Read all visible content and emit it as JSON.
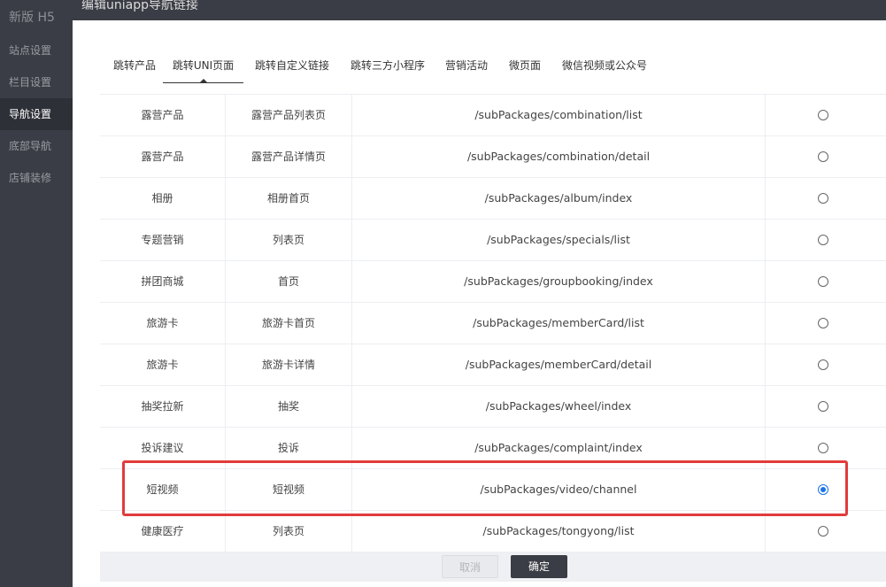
{
  "sidebar": {
    "brand": "新版 H5",
    "items": [
      {
        "label": "站点设置"
      },
      {
        "label": "栏目设置"
      },
      {
        "label": "导航设置"
      },
      {
        "label": "底部导航"
      },
      {
        "label": "店铺装修"
      }
    ],
    "active_index": 2
  },
  "dialog": {
    "title": "编辑uniapp导航链接"
  },
  "tabs": [
    {
      "label": "跳转产品"
    },
    {
      "label": "跳转UNI页面"
    },
    {
      "label": "跳转自定义链接"
    },
    {
      "label": "跳转三方小程序"
    },
    {
      "label": "营销活动"
    },
    {
      "label": "微页面"
    },
    {
      "label": "微信视频或公众号"
    }
  ],
  "active_tab": 1,
  "rows": [
    {
      "module": "露营产品",
      "page": "露营产品列表页",
      "path": "/subPackages/combination/list",
      "selected": false
    },
    {
      "module": "露营产品",
      "page": "露营产品详情页",
      "path": "/subPackages/combination/detail",
      "selected": false
    },
    {
      "module": "相册",
      "page": "相册首页",
      "path": "/subPackages/album/index",
      "selected": false
    },
    {
      "module": "专题营销",
      "page": "列表页",
      "path": "/subPackages/specials/list",
      "selected": false
    },
    {
      "module": "拼团商城",
      "page": "首页",
      "path": "/subPackages/groupbooking/index",
      "selected": false
    },
    {
      "module": "旅游卡",
      "page": "旅游卡首页",
      "path": "/subPackages/memberCard/list",
      "selected": false
    },
    {
      "module": "旅游卡",
      "page": "旅游卡详情",
      "path": "/subPackages/memberCard/detail",
      "selected": false
    },
    {
      "module": "抽奖拉新",
      "page": "抽奖",
      "path": "/subPackages/wheel/index",
      "selected": false
    },
    {
      "module": "投诉建议",
      "page": "投诉",
      "path": "/subPackages/complaint/index",
      "selected": false
    },
    {
      "module": "短视频",
      "page": "短视频",
      "path": "/subPackages/video/channel",
      "selected": true
    },
    {
      "module": "健康医疗",
      "page": "列表页",
      "path": "/subPackages/tongyong/list",
      "selected": false
    }
  ],
  "footer": {
    "cancel_label": "取消",
    "confirm_label": "确定"
  },
  "colors": {
    "sidebar_bg": "#3a3d45",
    "radio_selected": "#1a73e8",
    "highlight_border": "#e23b3b"
  }
}
